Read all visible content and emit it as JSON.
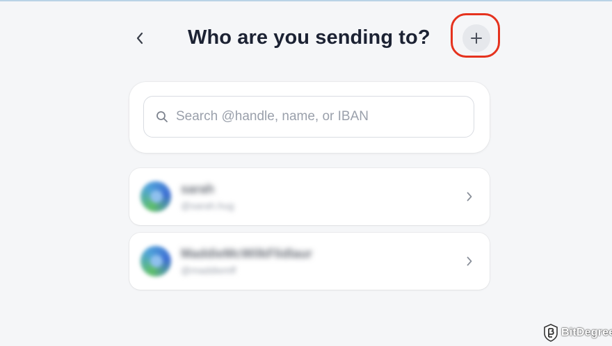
{
  "header": {
    "title": "Who are you sending to?",
    "back_icon": "chevron-left-icon",
    "add_icon": "plus-icon",
    "highlight_color": "#e5321e"
  },
  "search": {
    "placeholder": "Search @handle, name, or IBAN",
    "value": "",
    "icon": "search-icon"
  },
  "contacts": [
    {
      "name": "sarah",
      "handle": "@sarah.hug",
      "chevron_icon": "chevron-right-icon"
    },
    {
      "name": "MaddieMcWilkFlidlaur",
      "handle": "@maddiemff",
      "chevron_icon": "chevron-right-icon"
    }
  ],
  "watermark": {
    "text": "BitDegree",
    "icon": "bitdegree-logo-icon"
  },
  "colors": {
    "background": "#f5f6f8",
    "title": "#1c2233",
    "placeholder": "#9aa0ab",
    "card": "#ffffff"
  }
}
